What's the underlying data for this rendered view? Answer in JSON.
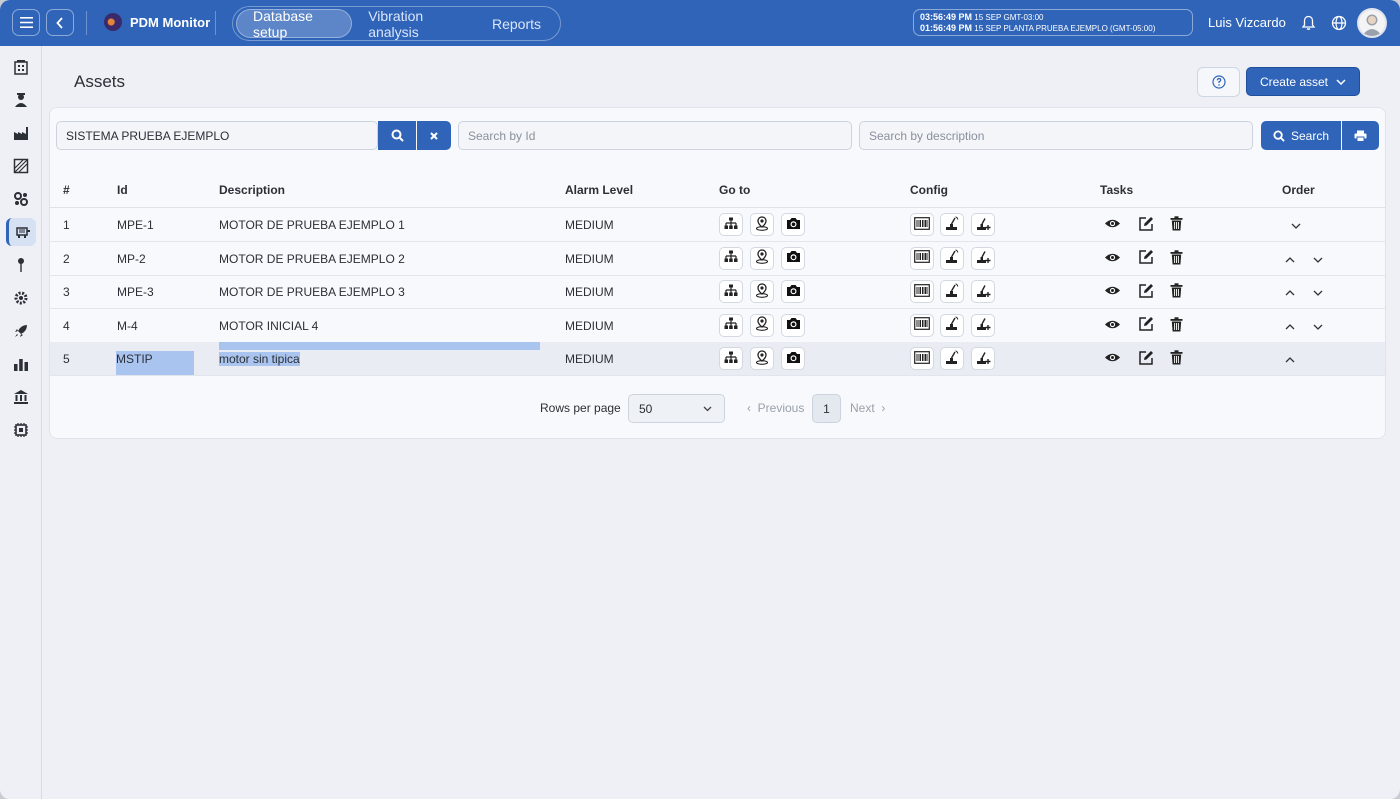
{
  "app": {
    "name": "PDM Monitor"
  },
  "nav": {
    "tabs": [
      {
        "label": "Database setup"
      },
      {
        "label": "Vibration analysis"
      },
      {
        "label": "Reports"
      }
    ]
  },
  "clock": {
    "line1_time": "03:56:49 PM",
    "line1_info": "15 SEP  GMT-03:00",
    "line2_time": "01:56:49 PM",
    "line2_info": "15 SEP  PLANTA PRUEBA EJEMPLO (GMT-05:00)"
  },
  "user": {
    "name": "Luis Vizcardo"
  },
  "page": {
    "title": "Assets",
    "create_label": "Create asset"
  },
  "filters": {
    "system_value": "SISTEMA PRUEBA EJEMPLO",
    "id_placeholder": "Search by Id",
    "description_placeholder": "Search by description",
    "search_label": "Search"
  },
  "table": {
    "headers": [
      "#",
      "Id",
      "Description",
      "Alarm Level",
      "Go to",
      "Config",
      "Tasks",
      "Order"
    ],
    "rows": [
      {
        "num": "1",
        "id": "MPE-1",
        "description": "MOTOR DE PRUEBA EJEMPLO 1",
        "alarm": "MEDIUM",
        "order_up": false,
        "order_down": true
      },
      {
        "num": "2",
        "id": "MP-2",
        "description": "MOTOR DE PRUEBA EJEMPLO 2",
        "alarm": "MEDIUM",
        "order_up": true,
        "order_down": true
      },
      {
        "num": "3",
        "id": "MPE-3",
        "description": "MOTOR DE PRUEBA EJEMPLO 3",
        "alarm": "MEDIUM",
        "order_up": true,
        "order_down": true
      },
      {
        "num": "4",
        "id": "M-4",
        "description": "MOTOR INICIAL 4",
        "alarm": "MEDIUM",
        "order_up": true,
        "order_down": true
      },
      {
        "num": "5",
        "id": "MSTIP",
        "description": "motor sin tipica",
        "alarm": "MEDIUM",
        "order_up": true,
        "order_down": false
      }
    ]
  },
  "pagination": {
    "rows_per_page_label": "Rows per page",
    "rows_per_page": "50",
    "previous": "Previous",
    "page": "1",
    "next": "Next"
  },
  "colors": {
    "accent": "#2f64b8",
    "background": "#eef0f5"
  }
}
